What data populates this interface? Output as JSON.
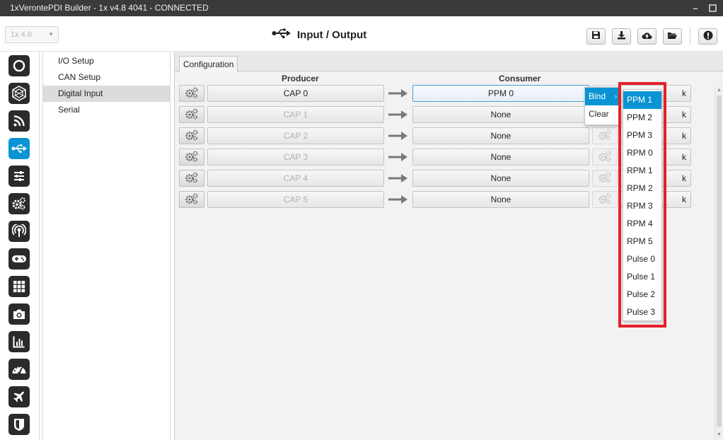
{
  "window": {
    "title": "1xVerontePDI Builder - 1x v4.8 4041 - CONNECTED"
  },
  "header": {
    "version": "1x 4.8",
    "page_title": "Input / Output",
    "title_icon": "usb-icon"
  },
  "toolbar": {
    "icons": [
      "save-icon",
      "download-icon",
      "cloud-upload-icon",
      "folder-open-icon",
      "alert-icon"
    ]
  },
  "side_icons": [
    "power-icon",
    "sphere-icon",
    "rss-icon",
    "usb-icon",
    "sliders-icon",
    "gears-icon",
    "broadcast-icon",
    "gamepad-icon",
    "grid-icon",
    "camera-icon",
    "chart-icon",
    "gauge-icon",
    "plane-icon",
    "shield-icon"
  ],
  "active_side_icon": "usb-icon",
  "nav": {
    "items": [
      "I/O Setup",
      "CAN Setup",
      "Digital Input",
      "Serial"
    ],
    "selected": "Digital Input"
  },
  "tab": "Configuration",
  "columns": {
    "producer": "Producer",
    "consumer": "Consumer"
  },
  "rows": [
    {
      "producer": "CAP 0",
      "consumer": "PPM 0",
      "trailing": "k"
    },
    {
      "producer": "CAP 1",
      "consumer": "None",
      "trailing": "k"
    },
    {
      "producer": "CAP 2",
      "consumer": "None",
      "trailing": "k"
    },
    {
      "producer": "CAP 3",
      "consumer": "None",
      "trailing": "k"
    },
    {
      "producer": "CAP 4",
      "consumer": "None",
      "trailing": "k"
    },
    {
      "producer": "CAP 5",
      "consumer": "None",
      "trailing": "k"
    }
  ],
  "context_menu": {
    "items": [
      "Bind",
      "Clear"
    ]
  },
  "submenu": {
    "items": [
      "PPM 1",
      "PPM 2",
      "PPM 3",
      "RPM 0",
      "RPM 1",
      "RPM 2",
      "RPM 3",
      "RPM 4",
      "RPM 5",
      "Pulse 0",
      "Pulse 1",
      "Pulse 2",
      "Pulse 3"
    ],
    "hovered": "PPM 1"
  },
  "colors": {
    "accent": "#0a94d4",
    "highlight": "#e5202c",
    "titlebar": "#3a3a3a",
    "icon_dark": "#2b2b2b"
  }
}
